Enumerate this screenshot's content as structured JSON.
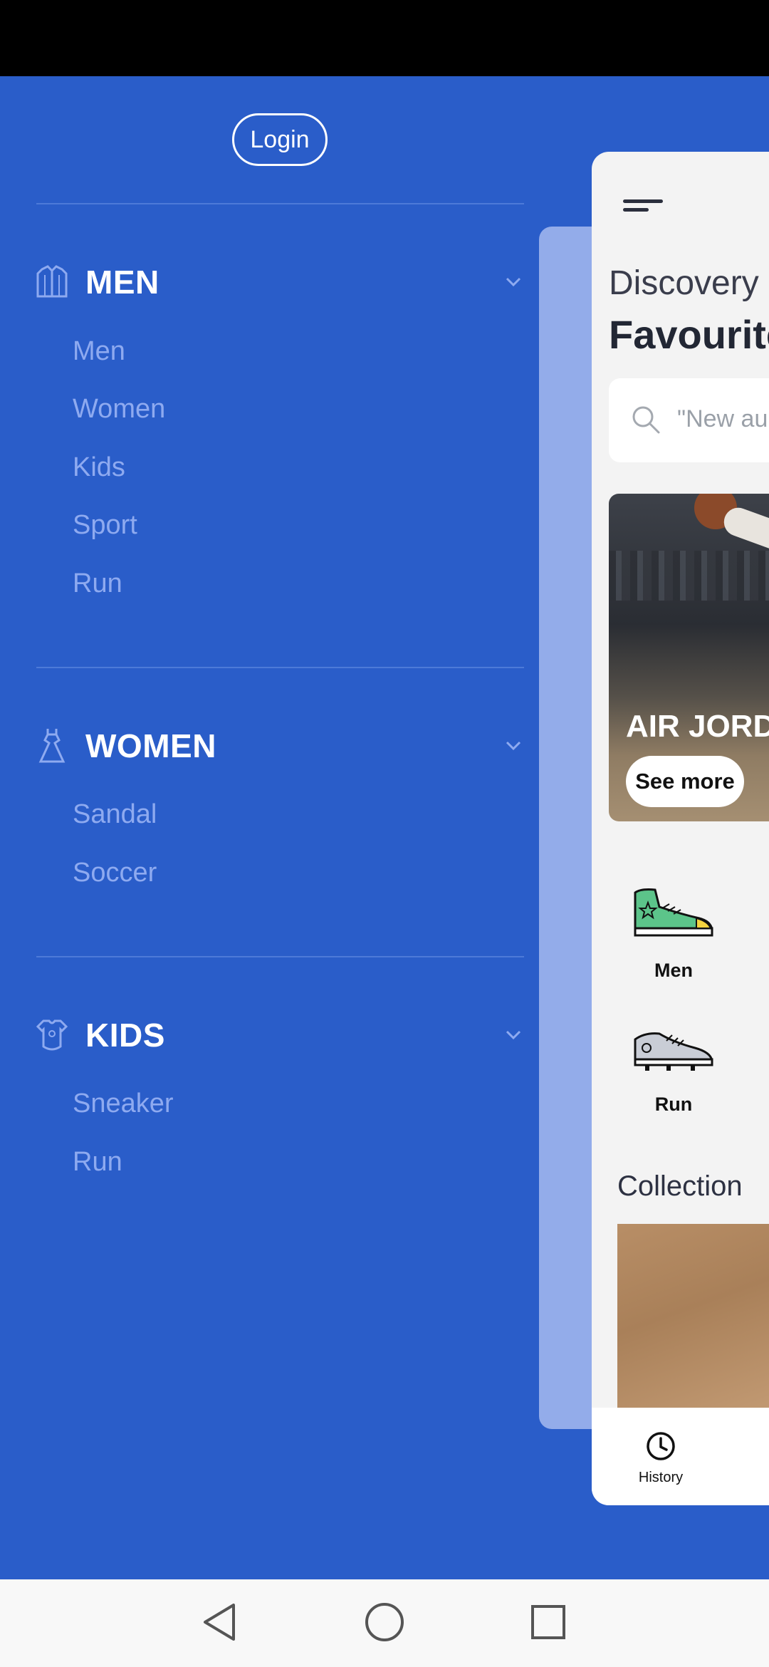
{
  "drawer": {
    "login_label": "Login",
    "sections": [
      {
        "title": "MEN",
        "icon": "jacket-icon",
        "items": [
          "Men",
          "Women",
          "Kids",
          "Sport",
          "Run"
        ]
      },
      {
        "title": "WOMEN",
        "icon": "dress-icon",
        "items": [
          "Sandal",
          "Soccer"
        ]
      },
      {
        "title": "KIDS",
        "icon": "baby-onesie-icon",
        "items": [
          "Sneaker",
          "Run"
        ]
      }
    ]
  },
  "preview": {
    "heading_light": "Discovery",
    "heading_bold": "Favourite",
    "search_placeholder": "\"New au",
    "banner_title": "AIR JORD",
    "banner_button": "See more",
    "categories": [
      {
        "label": "Men",
        "icon": "high-top-sneaker-icon"
      },
      {
        "label": "Run",
        "icon": "running-shoe-icon"
      }
    ],
    "collection_title": "Collection",
    "tab_history_label": "History"
  },
  "colors": {
    "drawer_bg": "#2a5dc9",
    "subitem_text": "#8eaaf0",
    "shadow_card": "#93acea"
  }
}
